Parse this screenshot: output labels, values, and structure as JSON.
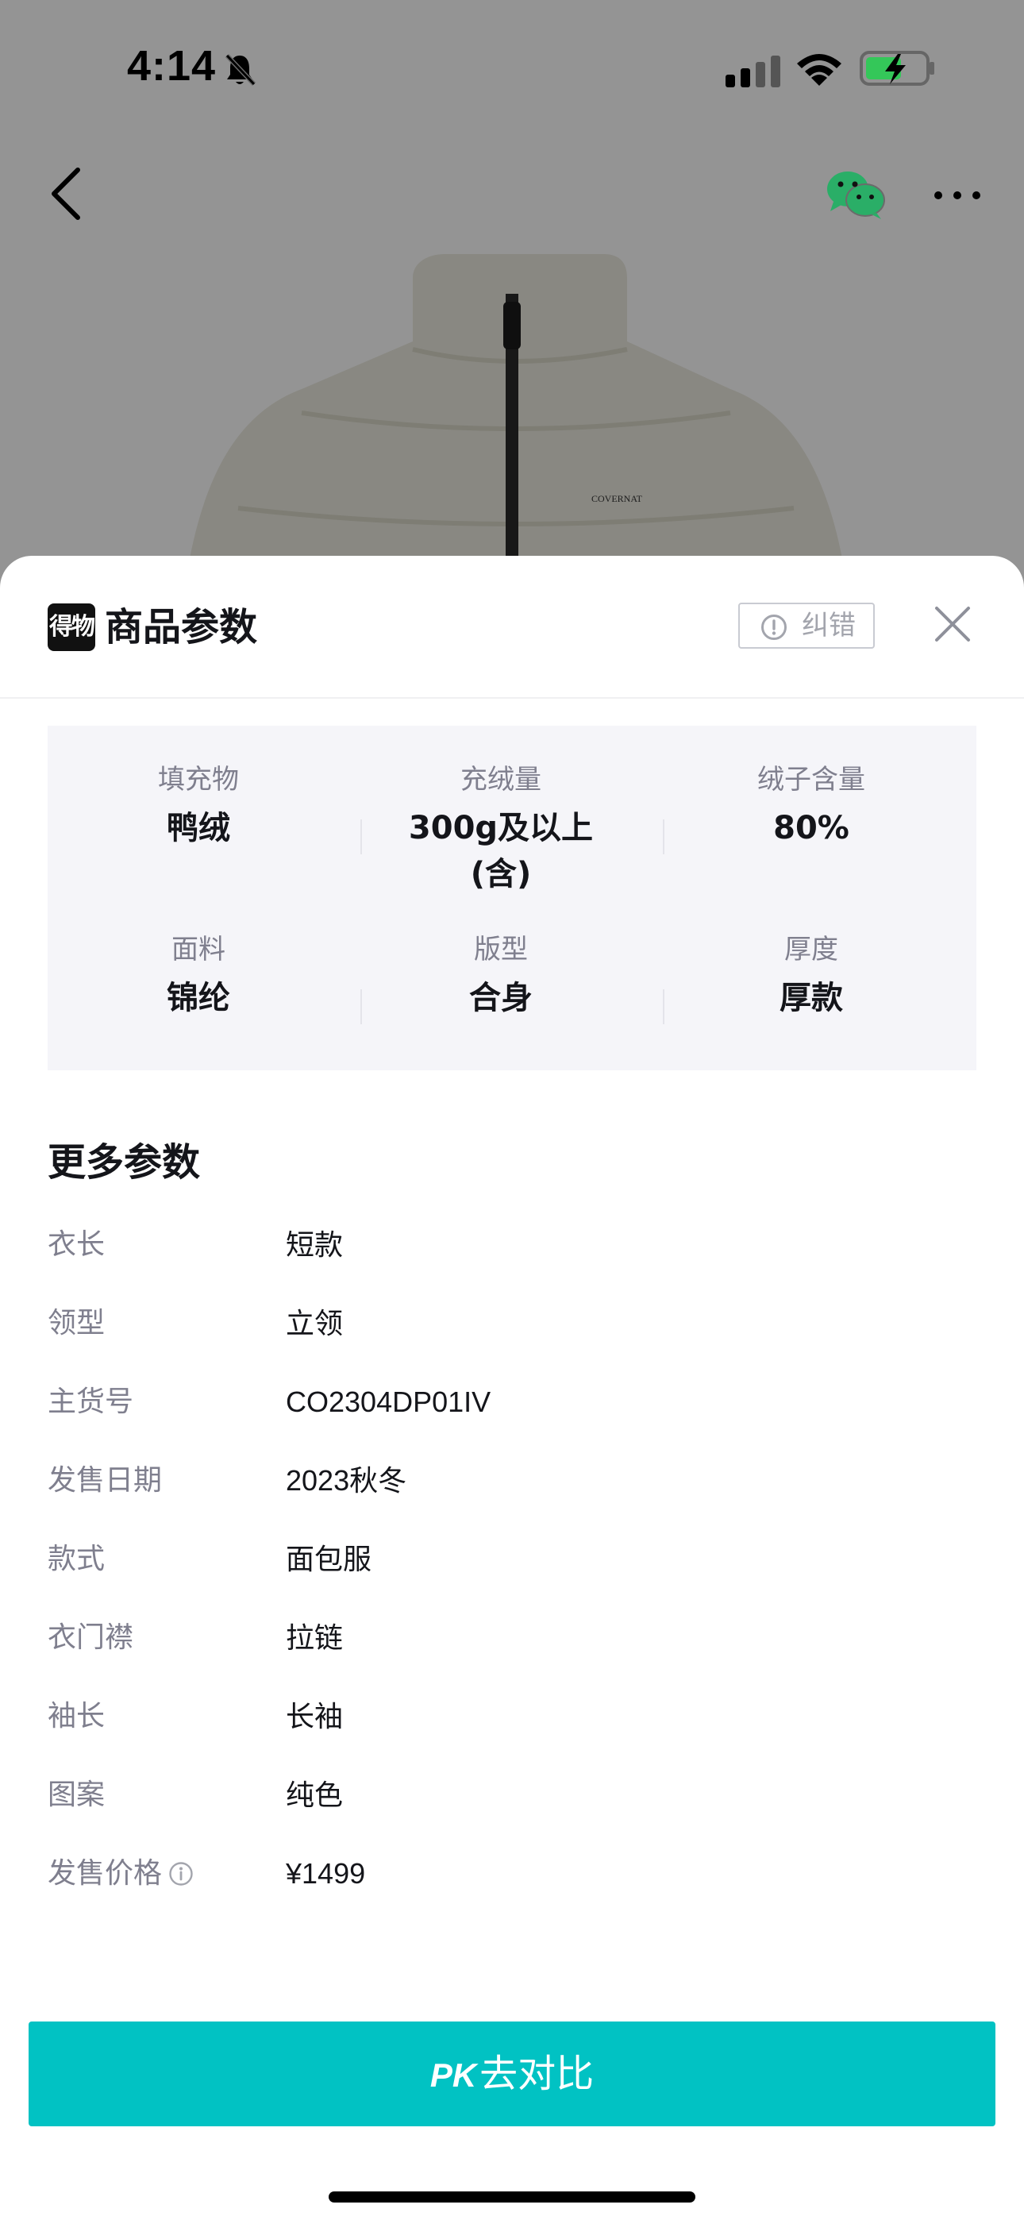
{
  "status_bar": {
    "time": "4:14"
  },
  "background": {
    "brand_text": "COVERNAT"
  },
  "sheet": {
    "logo_text": "得物",
    "title": "商品参数",
    "correct_label": "纠错"
  },
  "key_params": [
    {
      "label": "填充物",
      "value": "鸭绒"
    },
    {
      "label": "充绒量",
      "value": "300g及以上",
      "value2": "(含)"
    },
    {
      "label": "绒子含量",
      "value": "80%"
    },
    {
      "label": "面料",
      "value": "锦纶"
    },
    {
      "label": "版型",
      "value": "合身"
    },
    {
      "label": "厚度",
      "value": "厚款"
    }
  ],
  "more": {
    "title": "更多参数",
    "rows": [
      {
        "label": "衣长",
        "value": "短款"
      },
      {
        "label": "领型",
        "value": "立领"
      },
      {
        "label": "主货号",
        "value": "CO2304DP01IV"
      },
      {
        "label": "发售日期",
        "value": "2023秋冬"
      },
      {
        "label": "款式",
        "value": "面包服"
      },
      {
        "label": "衣门襟",
        "value": "拉链"
      },
      {
        "label": "袖长",
        "value": "长袖"
      },
      {
        "label": "图案",
        "value": "纯色"
      },
      {
        "label": "发售价格",
        "value": "¥1499"
      }
    ]
  },
  "pk_button": {
    "prefix": "PK",
    "label": "去对比"
  },
  "colors": {
    "accent": "#01c2c3",
    "text_primary": "#14151a",
    "text_secondary": "#7f7f8e",
    "params_bg": "#f5f5f9",
    "wechat_green": "#2aae67"
  }
}
